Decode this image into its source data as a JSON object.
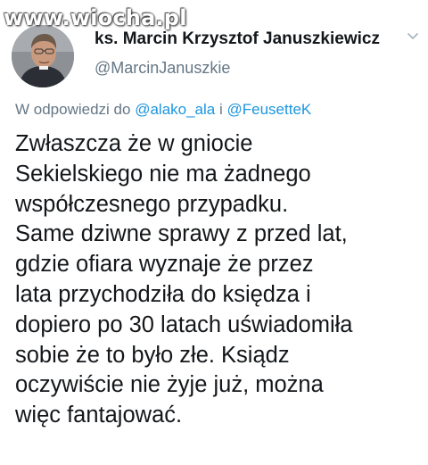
{
  "watermark": {
    "text": "www.wiocha.pl"
  },
  "author": {
    "name": "ks. Marcin Krzysztof Januszkiewicz",
    "handle": "@MarcinJanuszkie"
  },
  "reply": {
    "prefix": "W odpowiedzi do",
    "mention1": "@alako_ala",
    "joiner": "i",
    "mention2": "@FeusetteK"
  },
  "tweet": {
    "lines": [
      "Zwłaszcza że w gniocie",
      "Sekielskiego nie ma żadnego",
      "współczesnego przypadku.",
      "Same dziwne sprawy z przed lat,",
      "gdzie ofiara wyznaje że przez",
      "lata przychodziła do księdza i",
      "dopiero po 30 latach uświadomiła",
      "sobie że to było złe. Ksiądz",
      "oczywiście nie żyje już, można",
      "więc fantajować."
    ]
  },
  "icons": {
    "menu": "chevron-down-icon",
    "avatar": "profile-photo"
  },
  "colors": {
    "text": "#14171a",
    "secondary": "#657786",
    "link": "#1b95e0"
  }
}
